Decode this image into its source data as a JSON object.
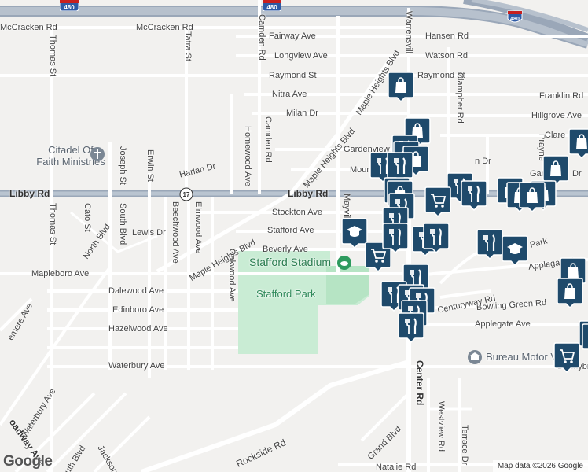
{
  "map": {
    "streets": {
      "mccracken_rd_left": "McCracken Rd",
      "mccracken_rd_right": "McCracken Rd",
      "fairway_ave": "Fairway Ave",
      "longview_ave": "Longview Ave",
      "raymond_st": "Raymond St",
      "nitra_ave": "Nitra Ave",
      "milan_dr": "Milan Dr",
      "hansen_rd": "Hansen Rd",
      "watson_rd": "Watson Rd",
      "raymond_st_east": "Raymond St",
      "franklin_rd": "Franklin Rd",
      "hillgrove_ave": "Hillgrove Ave",
      "clare": "Clare",
      "gardenview": "Gardenview",
      "mount": "Mount",
      "harlan_dr": "Harlan Dr",
      "libby_rd_left": "Libby Rd",
      "libby_rd_center": "Libby Rd",
      "stockton_ave": "Stockton Ave",
      "stafford_ave": "Stafford Ave",
      "beverly_ave": "Beverly Ave",
      "lewis_dr": "Lewis Dr",
      "north_blvd": "North Blvd",
      "mapleboro_ave": "Mapleboro Ave",
      "dalewood_ave": "Dalewood Ave",
      "edinboro_ave": "Edinboro Ave",
      "hazelwood_ave": "Hazelwood Ave",
      "waterbury_ave": "Waterbury Ave",
      "waterbury_ave_sw": "Waterbury Ave",
      "centuryway_rd": "Centuryway Rd",
      "bowling_green_rd": "Bowling Green Rd",
      "applegate_ave": "Applegate Ave",
      "applegate_park": "Applegate Par",
      "donnybr": "Donnybr",
      "rockside_rd": "Rockside Rd",
      "grand_blvd": "Grand Blvd",
      "natalie_rd": "Natalie Rd",
      "thomas_st_top": "Thomas St",
      "thomas_st": "Thomas St",
      "tatra_st": "Tatra St",
      "camden_rd_top": "Camden Rd",
      "camden_rd": "Camden Rd",
      "homewood_ave": "Homewood Ave",
      "maple_heights_blvd_top": "Maple Heights Blvd",
      "maple_heights_blvd_mid": "Maple Heights Blvd",
      "maple_heights_blvd_low": "Maple Heights Blvd",
      "warrensville": "Warrensvill",
      "clampher_rd": "Clampher Rd",
      "prayner": "Prayne",
      "cato_st": "Cato St",
      "joseph_st": "Joseph St",
      "south_blvd": "South Blvd",
      "erwin_st": "Erwin St",
      "beechwood_ave": "Beechwood Ave",
      "elmwood_ave": "Elmwood Ave",
      "oakwood_ave": "Oakwood Ave",
      "mayville_ave": "Mayville Ave",
      "center_rd": "Center Rd",
      "westview_rd": "Westview Rd",
      "terrace_dr": "Terrace Dr",
      "south_blvd_sw": "South Blvd",
      "jackson_blvd": "Jackson Blvd",
      "broadway_ave": "oadway Ave",
      "merne_ave": "emere Ave",
      "gar_dr": "Gar",
      "dr_east": "Dr",
      "n_dr": "n Dr",
      "ngate_park": "ngate Park"
    },
    "places": {
      "citadel": "Citadel Of Faith Ministries",
      "citadel_line1": "Citadel Of",
      "citadel_line2": "Faith Ministries",
      "stadium": "Stafford Stadium",
      "park": "Stafford Park",
      "bureau": "Bureau Motor Vehicl"
    },
    "shields": {
      "i480_top": "480",
      "i480_left": "480",
      "i480_right": "480",
      "route17": "17"
    },
    "attribution": "Map data ©2026 Google",
    "logo": "Google"
  },
  "colors": {
    "background": "#f2f1ef",
    "road": "#ffffff",
    "highway": "#9aa7b8",
    "park": "#c9ecd4",
    "pin": "#1f4a6b",
    "interstate_red": "#c8201e",
    "interstate_blue": "#2d5aa5"
  },
  "pins": [
    {
      "type": "shopping-bag",
      "label": "shopping"
    },
    {
      "type": "fork-knife",
      "label": "restaurant"
    },
    {
      "type": "shopping-cart",
      "label": "grocery"
    },
    {
      "type": "graduation-cap",
      "label": "school"
    }
  ]
}
